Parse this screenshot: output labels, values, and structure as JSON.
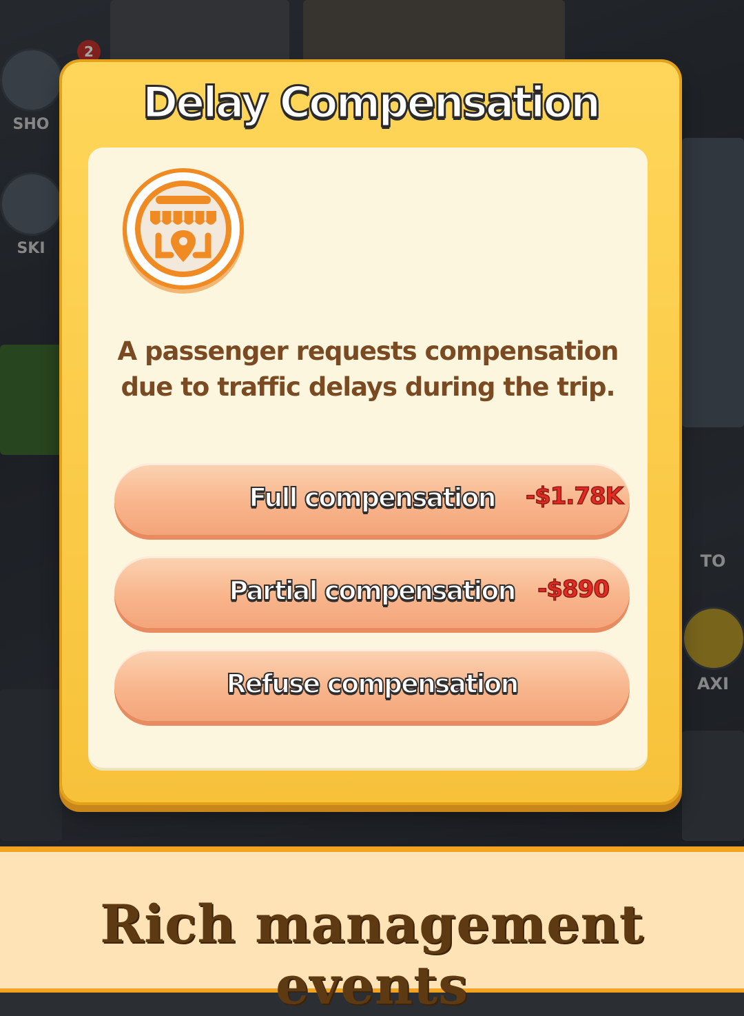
{
  "background": {
    "left_buttons": [
      {
        "label": "SHO",
        "badge": "2"
      },
      {
        "label": "SKI"
      }
    ],
    "right_buttons": [
      {
        "label": "TO"
      },
      {
        "label": "AXI"
      }
    ]
  },
  "dialog": {
    "title": "Delay Compensation",
    "icon": "shop-location-icon",
    "description": "A passenger requests compensation due to traffic delays during the trip.",
    "options": [
      {
        "label": "Full compensation",
        "cost": "-$1.78K"
      },
      {
        "label": "Partial compensation",
        "cost": "-$890"
      },
      {
        "label": "Refuse compensation",
        "cost": ""
      }
    ]
  },
  "banner": {
    "text": "Rich management events"
  },
  "colors": {
    "dialog_frame": "#f7c23a",
    "panel": "#fdf6df",
    "option_button": "#f8b58c",
    "cost_text": "#e32b22",
    "banner_bg": "#fde3b6",
    "banner_text": "#5e3a12"
  }
}
